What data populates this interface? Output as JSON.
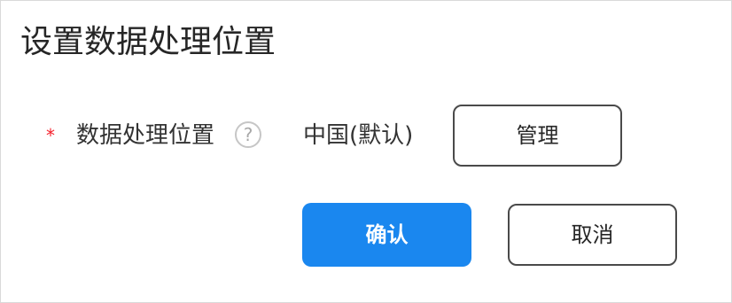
{
  "dialog": {
    "title": "设置数据处理位置"
  },
  "form": {
    "required_mark": "*",
    "label": "数据处理位置",
    "help_icon_glyph": "?",
    "help_icon_name": "question-circle-icon",
    "value": "中国(默认)",
    "manage_label": "管理"
  },
  "footer": {
    "confirm_label": "确认",
    "cancel_label": "取消"
  },
  "colors": {
    "primary": "#1a87ef",
    "required": "#f5222d",
    "border": "#4a4a4a"
  }
}
